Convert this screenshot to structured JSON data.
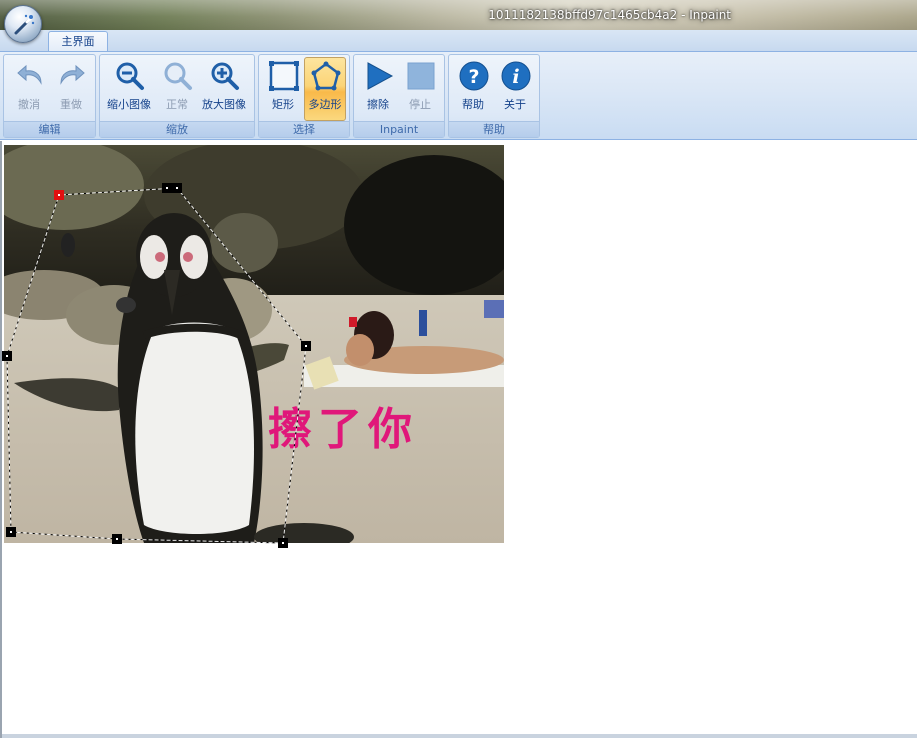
{
  "window": {
    "title": "1011182138bffd97c1465cb4a2 - Inpaint",
    "app_icon": "wand-icon"
  },
  "ribbon": {
    "tabs": [
      {
        "label": "主界面",
        "active": true
      }
    ],
    "groups": [
      {
        "label": "编辑",
        "buttons": [
          {
            "label": "撤消",
            "icon": "undo-icon",
            "enabled": false
          },
          {
            "label": "重做",
            "icon": "redo-icon",
            "enabled": false
          }
        ]
      },
      {
        "label": "缩放",
        "buttons": [
          {
            "label": "缩小图像",
            "icon": "zoom-out-icon",
            "enabled": true
          },
          {
            "label": "正常",
            "icon": "zoom-normal-icon",
            "enabled": false
          },
          {
            "label": "放大图像",
            "icon": "zoom-in-icon",
            "enabled": true
          }
        ]
      },
      {
        "label": "选择",
        "buttons": [
          {
            "label": "矩形",
            "icon": "rectangle-select-icon",
            "enabled": true,
            "active": false
          },
          {
            "label": "多边形",
            "icon": "polygon-select-icon",
            "enabled": true,
            "active": true
          }
        ]
      },
      {
        "label": "Inpaint",
        "buttons": [
          {
            "label": "擦除",
            "icon": "play-icon",
            "enabled": true
          },
          {
            "label": "停止",
            "icon": "stop-icon",
            "enabled": false
          }
        ]
      },
      {
        "label": "帮助",
        "buttons": [
          {
            "label": "帮助",
            "icon": "help-icon",
            "enabled": true
          },
          {
            "label": "关于",
            "icon": "info-icon",
            "enabled": true
          }
        ]
      }
    ]
  },
  "canvas": {
    "overlay_text": "擦了你",
    "overlay_text_color": "#e0177a",
    "selection_handle_color": "#e01010"
  },
  "colors": {
    "ribbon_text": "#15428b",
    "active_button": "#fbd477"
  }
}
